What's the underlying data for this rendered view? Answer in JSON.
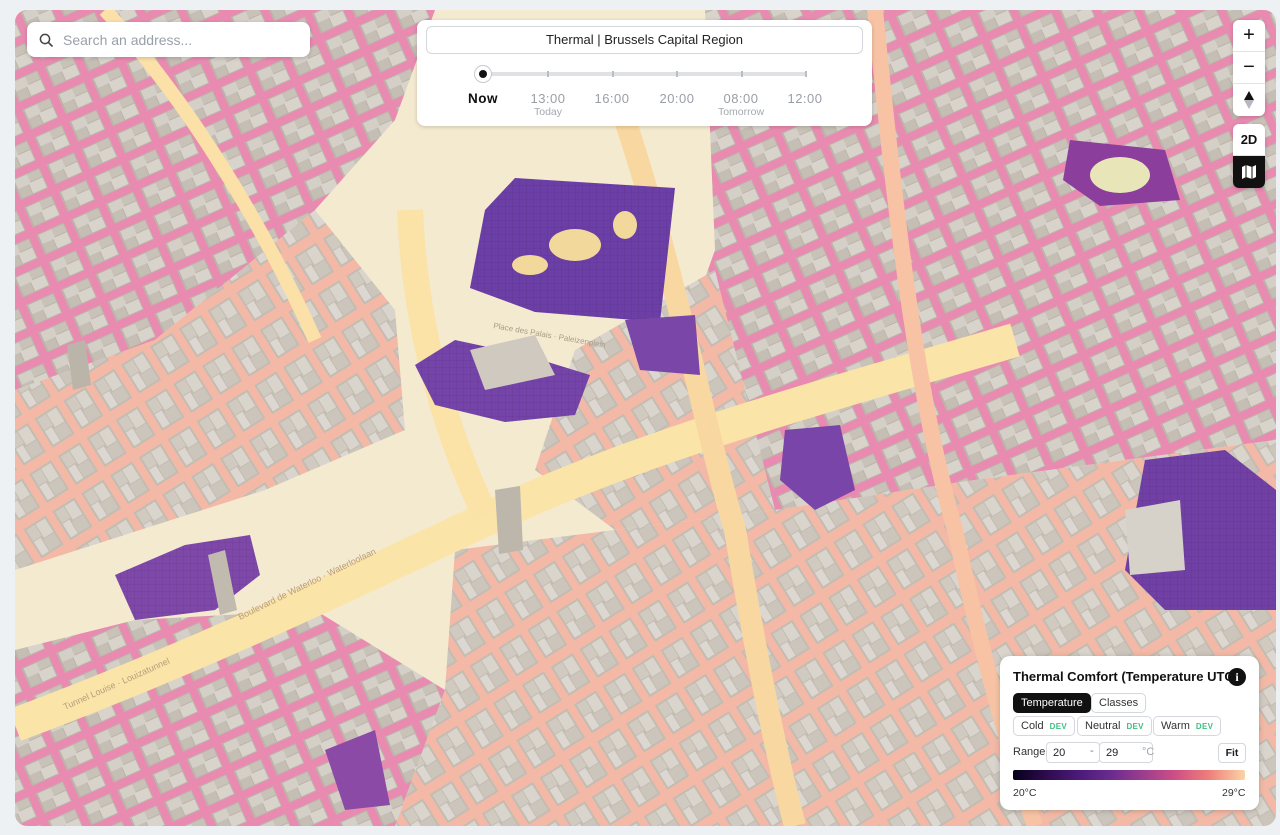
{
  "search": {
    "placeholder": "Search an address..."
  },
  "layer_title": "Thermal | Brussels Capital Region",
  "timeline": {
    "labels": [
      "Now",
      "13:00",
      "16:00",
      "20:00",
      "08:00",
      "12:00"
    ],
    "sublabels": {
      "today": "Today",
      "tomorrow": "Tomorrow"
    }
  },
  "controls": {
    "zoom_in": "+",
    "zoom_out": "−",
    "north": "▲",
    "view_2d": "2D"
  },
  "legend": {
    "title": "Thermal Comfort (Temperature UTCI)",
    "info": "i",
    "tabs": [
      "Temperature",
      "Classes"
    ],
    "classes": [
      "Cold",
      "Neutral",
      "Warm"
    ],
    "dev_badge": "DEV",
    "range_label": "Range",
    "range_min": "20",
    "range_max": "29",
    "range_dash": "-",
    "range_unit": "°C",
    "fit": "Fit",
    "scale_min": "20°C",
    "scale_max": "29°C"
  },
  "map_labels": {
    "place_des_palais": "Place des Palais · Paleizenplein",
    "boulevard_waterloo": "Boulevard de Waterloo · Waterloolaan",
    "tunnel_louise": "Tunnel Louise · Louizatunnel"
  },
  "colors": {
    "map_base": "#f4ead0",
    "building": "#cac4bb",
    "cool_purple": "#6a3fa3",
    "warm_pink": "#d54f8e",
    "hot_yellow": "#fbe8b2"
  }
}
